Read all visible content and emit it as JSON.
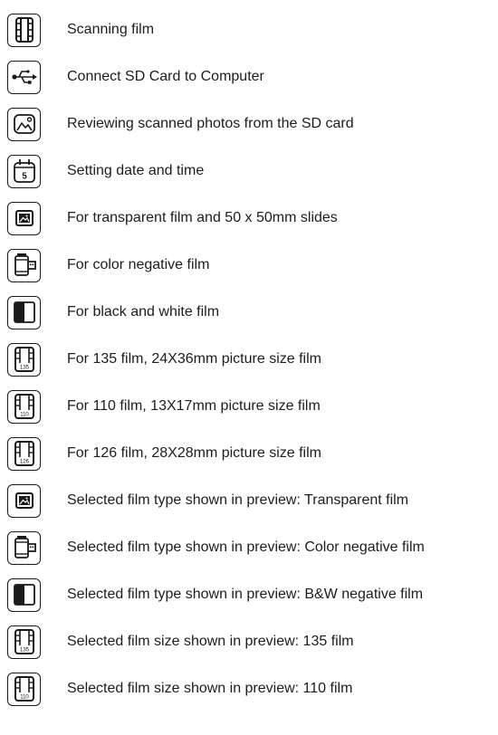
{
  "legend": {
    "items": [
      {
        "icon": "film-strip-icon",
        "label": "Scanning film"
      },
      {
        "icon": "usb-icon",
        "label": "Connect SD Card to Computer"
      },
      {
        "icon": "photo-icon",
        "label": "Reviewing scanned photos from the SD card"
      },
      {
        "icon": "calendar-icon",
        "label": "Setting date and time",
        "icon_text": "5"
      },
      {
        "icon": "slide-icon",
        "label": "For transparent film and 50 x 50mm slides"
      },
      {
        "icon": "film-canister-icon",
        "label": "For color negative film"
      },
      {
        "icon": "black-white-icon",
        "label": "For black and white film"
      },
      {
        "icon": "film-135-icon",
        "label": "For 135 film, 24X36mm picture size film",
        "icon_text": "135"
      },
      {
        "icon": "film-110-icon",
        "label": "For 110 film, 13X17mm picture size film",
        "icon_text": "110"
      },
      {
        "icon": "film-126-icon",
        "label": "For 126 film, 28X28mm picture size film",
        "icon_text": "126"
      },
      {
        "icon": "slide-icon",
        "label": "Selected film type shown in preview: Transparent film"
      },
      {
        "icon": "film-canister-icon",
        "label": "Selected film type shown in preview: Color negative film"
      },
      {
        "icon": "black-white-icon",
        "label": "Selected film type shown in preview: B&W negative film"
      },
      {
        "icon": "film-135-icon",
        "label": "Selected film size shown in preview: 135 film",
        "icon_text": "135"
      },
      {
        "icon": "film-110-icon",
        "label": "Selected film size shown in preview: 110 film",
        "icon_text": "110"
      }
    ]
  }
}
